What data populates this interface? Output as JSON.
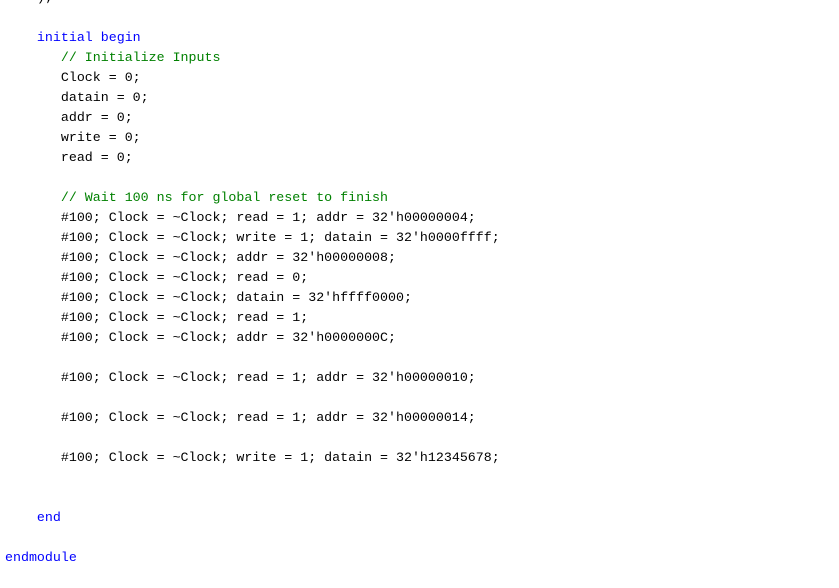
{
  "colors": {
    "keyword": "#0000ff",
    "comment": "#008000",
    "text": "#000000",
    "background": "#ffffff"
  },
  "code": {
    "lines": [
      {
        "segments": [
          {
            "text": "    );",
            "type": "text"
          }
        ]
      },
      {
        "segments": []
      },
      {
        "segments": [
          {
            "text": "    initial begin",
            "type": "keyword"
          }
        ]
      },
      {
        "segments": [
          {
            "text": "       // Initialize Inputs",
            "type": "comment"
          }
        ]
      },
      {
        "segments": [
          {
            "text": "       Clock = 0;",
            "type": "text"
          }
        ]
      },
      {
        "segments": [
          {
            "text": "       datain = 0;",
            "type": "text"
          }
        ]
      },
      {
        "segments": [
          {
            "text": "       addr = 0;",
            "type": "text"
          }
        ]
      },
      {
        "segments": [
          {
            "text": "       write = 0;",
            "type": "text"
          }
        ]
      },
      {
        "segments": [
          {
            "text": "       read = 0;",
            "type": "text"
          }
        ]
      },
      {
        "segments": []
      },
      {
        "segments": [
          {
            "text": "       // Wait 100 ns for global reset to finish",
            "type": "comment"
          }
        ]
      },
      {
        "segments": [
          {
            "text": "       #100; Clock = ~Clock; read = 1; addr = 32'h00000004;",
            "type": "text"
          }
        ]
      },
      {
        "segments": [
          {
            "text": "       #100; Clock = ~Clock; write = 1; datain = 32'h0000ffff;",
            "type": "text"
          }
        ]
      },
      {
        "segments": [
          {
            "text": "       #100; Clock = ~Clock; addr = 32'h00000008;",
            "type": "text"
          }
        ]
      },
      {
        "segments": [
          {
            "text": "       #100; Clock = ~Clock; read = 0;",
            "type": "text"
          }
        ]
      },
      {
        "segments": [
          {
            "text": "       #100; Clock = ~Clock; datain = 32'hffff0000;",
            "type": "text"
          }
        ]
      },
      {
        "segments": [
          {
            "text": "       #100; Clock = ~Clock; read = 1;",
            "type": "text"
          }
        ]
      },
      {
        "segments": [
          {
            "text": "       #100; Clock = ~Clock; addr = 32'h0000000C;",
            "type": "text"
          }
        ]
      },
      {
        "segments": []
      },
      {
        "segments": [
          {
            "text": "       #100; Clock = ~Clock; read = 1; addr = 32'h00000010;",
            "type": "text"
          }
        ]
      },
      {
        "segments": []
      },
      {
        "segments": [
          {
            "text": "       #100; Clock = ~Clock; read = 1; addr = 32'h00000014;",
            "type": "text"
          }
        ]
      },
      {
        "segments": []
      },
      {
        "segments": [
          {
            "text": "       #100; Clock = ~Clock; write = 1; datain = 32'h12345678;",
            "type": "text"
          }
        ]
      },
      {
        "segments": []
      },
      {
        "segments": []
      },
      {
        "segments": [
          {
            "text": "    end",
            "type": "keyword"
          }
        ]
      },
      {
        "segments": []
      },
      {
        "segments": [
          {
            "text": "endmodule",
            "type": "keyword"
          }
        ]
      }
    ]
  }
}
